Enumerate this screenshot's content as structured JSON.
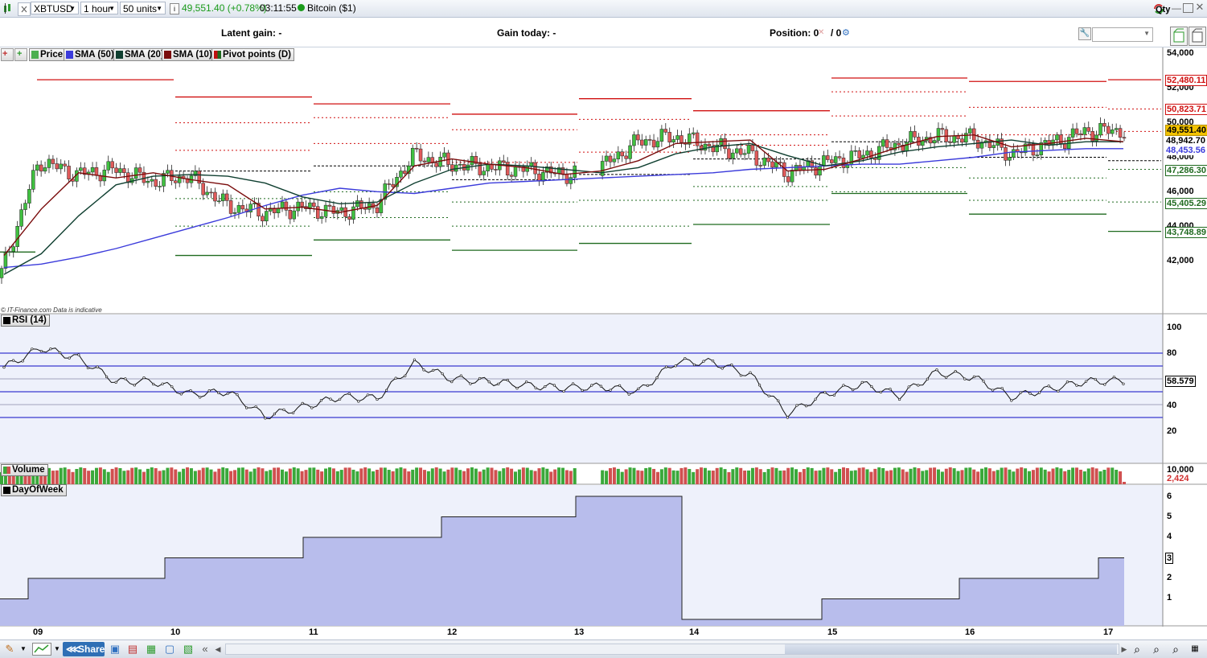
{
  "toolbar": {
    "symbol": "XBTUSD",
    "interval": "1 hour",
    "units": "50 units",
    "price_info": "49,551.40 (+0.78%)",
    "time": "03:11:55",
    "instrument": "Bitcoin ($1)",
    "qty_label": "Qty",
    "up_color": "#1a9b1a"
  },
  "infobar": {
    "latent_gain": "Latent gain: -",
    "gain_today": "Gain today: -",
    "position_label": "Position: 0",
    "position_sep": "/ 0"
  },
  "legend": [
    {
      "label": "Price",
      "color": "#4caf50"
    },
    {
      "label": "SMA (50)",
      "color": "#3b3bdb"
    },
    {
      "label": "SMA (20)",
      "color": "#0f3f30"
    },
    {
      "label": "SMA (10)",
      "color": "#7a0c0c"
    },
    {
      "label": "Pivot points (D)",
      "color": "#1f6a1f"
    }
  ],
  "watermark": "© IT-Finance.com  Data is indicative",
  "price_axis": [
    "54,000",
    "52,000",
    "50,000",
    "48,000",
    "46,000",
    "44,000",
    "42,000"
  ],
  "price_tags": [
    {
      "value": "52,480.11",
      "color": "#d01010"
    },
    {
      "value": "50,823.71",
      "color": "#d01010"
    },
    {
      "value": "49,551.40",
      "color": "#000000",
      "bg": "#f2c200"
    },
    {
      "value": "48,942.70",
      "color": "#000000"
    },
    {
      "value": "48,453.56",
      "color": "#3b3bdb"
    },
    {
      "value": "47,286.30",
      "color": "#1f6a1f"
    },
    {
      "value": "45,405.29",
      "color": "#1f6a1f"
    },
    {
      "value": "43,748.89",
      "color": "#1f6a1f"
    }
  ],
  "rsi": {
    "label": "RSI (14)",
    "axis": [
      "100",
      "80",
      "60",
      "40",
      "20"
    ],
    "current": "58.579",
    "levels": [
      80,
      70,
      50,
      30
    ]
  },
  "volume": {
    "label": "Volume",
    "axis_top": "10,000",
    "current": "2,424"
  },
  "dow": {
    "label": "DayOfWeek",
    "axis": [
      "6",
      "5",
      "4",
      "3",
      "2",
      "1"
    ],
    "current": "3",
    "steps": [
      {
        "x0": 0,
        "x1": 35,
        "v": 1
      },
      {
        "x0": 35,
        "x1": 205,
        "v": 2
      },
      {
        "x0": 205,
        "x1": 377,
        "v": 3
      },
      {
        "x0": 377,
        "x1": 549,
        "v": 4
      },
      {
        "x0": 549,
        "x1": 716,
        "v": 5
      },
      {
        "x0": 716,
        "x1": 848,
        "v": 6
      },
      {
        "x0": 848,
        "x1": 1022,
        "v": 0
      },
      {
        "x0": 1022,
        "x1": 1193,
        "v": 1
      },
      {
        "x0": 1193,
        "x1": 1366,
        "v": 2
      },
      {
        "x0": 1366,
        "x1": 1398,
        "v": 3
      }
    ]
  },
  "date_axis": [
    "09",
    "10",
    "11",
    "12",
    "13",
    "14",
    "15",
    "16",
    "17"
  ],
  "bottombar": {
    "share_label": "Share"
  },
  "chart_data": {
    "type": "line",
    "title": "",
    "series": [
      {
        "name": "SMA (50)",
        "y": [
          41.6,
          41.8,
          42.2,
          42.7,
          43.3,
          43.9,
          44.5,
          45.2,
          45.8,
          46.2,
          46.0,
          45.9,
          46.2,
          46.5,
          46.6,
          46.7,
          46.8,
          46.9,
          47.0,
          47.1,
          47.3,
          47.4,
          47.5,
          47.6,
          47.6,
          47.8,
          48.0,
          48.3,
          48.4,
          48.5,
          48.5
        ]
      },
      {
        "name": "SMA (20)",
        "y": [
          41.2,
          42.4,
          44.6,
          46.4,
          46.9,
          47.0,
          46.9,
          46.5,
          45.7,
          45.3,
          45.4,
          46.5,
          47.3,
          47.6,
          47.5,
          47.3,
          47.1,
          47.4,
          48.2,
          48.6,
          48.8,
          48.1,
          47.5,
          47.8,
          48.3,
          48.6,
          48.8,
          49.0,
          48.7,
          48.9,
          48.9
        ]
      },
      {
        "name": "SMA (10)",
        "y": [
          42.3,
          45.0,
          47.1,
          46.8,
          47.1,
          46.7,
          46.4,
          45.0,
          45.1,
          44.8,
          45.2,
          47.5,
          47.9,
          47.6,
          47.4,
          47.0,
          47.2,
          47.8,
          48.8,
          48.9,
          49.0,
          47.2,
          47.3,
          47.9,
          48.6,
          49.2,
          49.3,
          48.6,
          48.8,
          49.1,
          48.9
        ]
      }
    ],
    "rsi": [
      69,
      84,
      76,
      58,
      58,
      48,
      50,
      31,
      38,
      46,
      45,
      72,
      60,
      58,
      55,
      53,
      54,
      50,
      73,
      73,
      63,
      33,
      48,
      56,
      47,
      65,
      61,
      46,
      52,
      58,
      58.6
    ],
    "close": [
      41.3,
      47.8,
      47.0,
      47.3,
      46.6,
      46.9,
      45.2,
      44.8,
      45.1,
      44.8,
      45.2,
      48.1,
      47.6,
      47.4,
      47.3,
      47.0,
      47.4,
      48.9,
      49.2,
      48.6,
      48.2,
      47.1,
      47.7,
      48.1,
      48.8,
      49.2,
      49.1,
      48.2,
      48.8,
      49.5,
      49.55
    ],
    "ylim": [
      41,
      54.5
    ],
    "rsi_ylim": [
      0,
      100
    ]
  }
}
